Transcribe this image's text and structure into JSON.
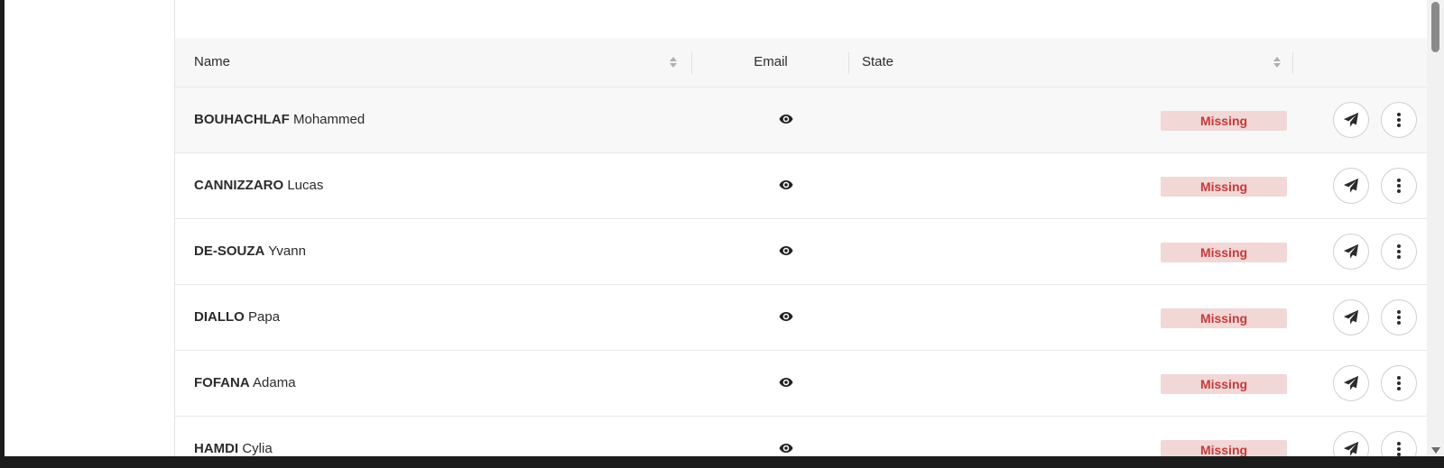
{
  "table": {
    "columns": {
      "name": "Name",
      "email": "Email",
      "state": "State"
    },
    "rows": [
      {
        "last": "BOUHACHLAF",
        "first": "Mohammed",
        "state": "Missing"
      },
      {
        "last": "CANNIZZARO",
        "first": "Lucas",
        "state": "Missing"
      },
      {
        "last": "DE-SOUZA",
        "first": "Yvann",
        "state": "Missing"
      },
      {
        "last": "DIALLO",
        "first": "Papa",
        "state": "Missing"
      },
      {
        "last": "FOFANA",
        "first": "Adama",
        "state": "Missing"
      },
      {
        "last": "HAMDI",
        "first": "Cylia",
        "state": "Missing"
      }
    ]
  },
  "icons": {
    "email": "eye-icon",
    "send": "send-icon",
    "more": "more-vertical-icon",
    "sort": "sort-icon"
  },
  "colors": {
    "badge_bg": "#f2d7d7",
    "badge_text": "#c63a3a"
  }
}
